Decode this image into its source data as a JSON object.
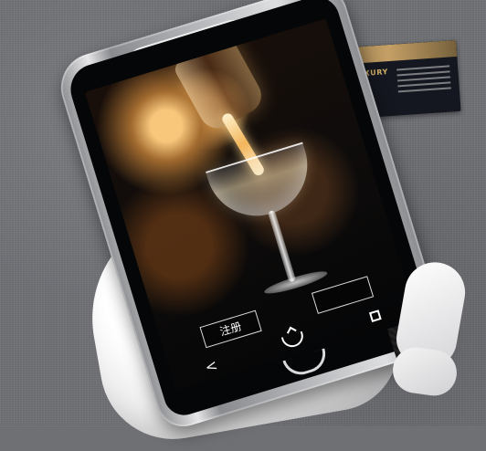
{
  "scene": {
    "description": "",
    "card": {
      "brand": "QZY LUXURY"
    },
    "phone": {
      "screen": {
        "buttons": {
          "register": "注册",
          "login": ""
        },
        "nav": {
          "back": "<",
          "home": "",
          "recent": ""
        }
      }
    }
  }
}
